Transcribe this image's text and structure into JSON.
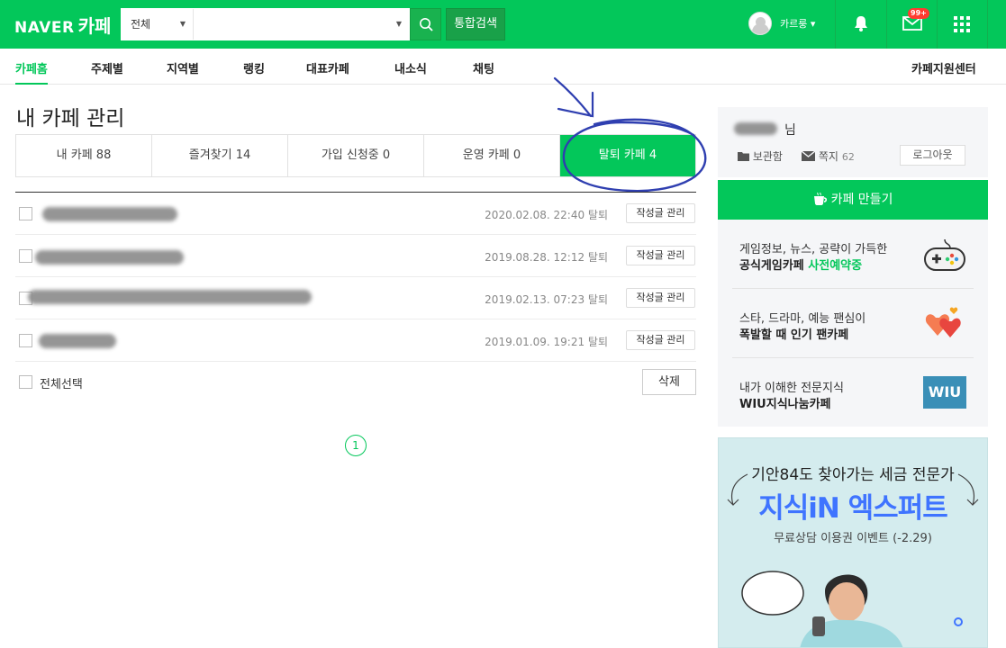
{
  "header": {
    "logo_naver": "NAVER",
    "logo_cafe": "카페",
    "search_scope": "전체",
    "search_value": "",
    "total_search_label": "통합검색",
    "user_name": "카르룽",
    "mail_badge": "99+"
  },
  "menu": {
    "items": [
      "카페홈",
      "주제별",
      "지역별",
      "랭킹",
      "대표카페",
      "내소식",
      "채팅"
    ],
    "support": "카페지원센터"
  },
  "page": {
    "title": "내 카페 관리",
    "tabs": [
      {
        "label": "내 카페 88"
      },
      {
        "label": "즐겨찾기 14"
      },
      {
        "label": "가입 신청중 0"
      },
      {
        "label": "운영 카페 0"
      },
      {
        "label": "탈퇴 카페 4"
      }
    ]
  },
  "rows": [
    {
      "date": "2020.02.08. 22:40 탈퇴",
      "button": "작성글 관리"
    },
    {
      "date": "2019.08.28. 12:12 탈퇴",
      "button": "작성글 관리"
    },
    {
      "date": "2019.02.13. 07:23 탈퇴",
      "button": "작성글 관리"
    },
    {
      "date": "2019.01.09. 19:21 탈퇴",
      "button": "작성글 관리"
    }
  ],
  "footer": {
    "select_all": "전체선택",
    "delete": "삭제",
    "page": "1"
  },
  "sidebar": {
    "nim": "님",
    "storage": "보관함",
    "notes": "쪽지",
    "notes_count": "62",
    "logout": "로그아웃",
    "make_cafe": "카페 만들기",
    "promos": [
      {
        "line1": "게임정보, 뉴스, 공략이 가득한",
        "line2a": "공식게임카페 ",
        "line2b": "사전예약중"
      },
      {
        "line1": "스타, 드라마, 예능 팬심이",
        "line2a": "폭발할 때 인기 팬카페",
        "line2b": ""
      },
      {
        "line1": "내가 이해한 전문지식",
        "line2a": "WIU지식나눔카페",
        "line2b": ""
      }
    ],
    "wiu_logo": "WIU",
    "ad": {
      "line1": "기안84도 찾아가는 세금 전문가",
      "line2": "지식iN 엑스퍼트",
      "line3": "무료상담 이용권 이벤트 (-2.29)"
    }
  },
  "colors": {
    "brand": "#03c75a",
    "annotation": "#2f3fb0"
  }
}
